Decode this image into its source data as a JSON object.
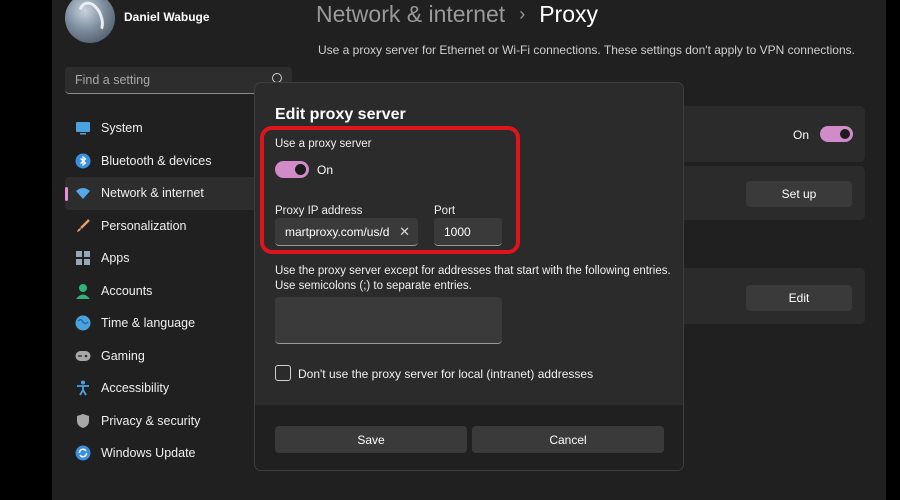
{
  "user": {
    "name": "Daniel Wabuge"
  },
  "search": {
    "placeholder": "Find a setting"
  },
  "sidebar": {
    "items": [
      {
        "label": "System",
        "icon": "monitor-icon",
        "color": "#4aa3df"
      },
      {
        "label": "Bluetooth & devices",
        "icon": "bluetooth-icon",
        "color": "#3b8fe0"
      },
      {
        "label": "Network & internet",
        "icon": "wifi-icon",
        "color": "#55a7e8"
      },
      {
        "label": "Personalization",
        "icon": "brush-icon",
        "color": "#e2a066"
      },
      {
        "label": "Apps",
        "icon": "apps-icon",
        "color": "#9aa7b4"
      },
      {
        "label": "Accounts",
        "icon": "person-icon",
        "color": "#2fb37a"
      },
      {
        "label": "Time & language",
        "icon": "globe-icon",
        "color": "#4aa3df"
      },
      {
        "label": "Gaming",
        "icon": "gamepad-icon",
        "color": "#a7a7a7"
      },
      {
        "label": "Accessibility",
        "icon": "accessibility-icon",
        "color": "#4aa3df"
      },
      {
        "label": "Privacy & security",
        "icon": "shield-icon",
        "color": "#a7a7a7"
      },
      {
        "label": "Windows Update",
        "icon": "update-icon",
        "color": "#3b8fe0"
      }
    ],
    "active_index": 2
  },
  "header": {
    "parent": "Network & internet",
    "separator": "›",
    "current": "Proxy",
    "subtitle": "Use a proxy server for Ethernet or Wi-Fi connections. These settings don't apply to VPN connections."
  },
  "background": {
    "auto_toggle_state": "On",
    "setup_label": "Set up",
    "edit_label": "Edit"
  },
  "dialog": {
    "title": "Edit proxy server",
    "use_proxy_label": "Use a proxy server",
    "toggle_state": "On",
    "ip_label": "Proxy IP address",
    "ip_value": "martproxy.com/us/d",
    "port_label": "Port",
    "port_value": "1000",
    "exceptions_desc_1": "Use the proxy server except for addresses that start with the following entries.",
    "exceptions_desc_2": "Use semicolons (;) to separate entries.",
    "local_checkbox_label": "Don't use the proxy server for local (intranet) addresses",
    "save_label": "Save",
    "cancel_label": "Cancel"
  },
  "colors": {
    "accent": "#d18bc9",
    "highlight": "#e0141c"
  }
}
